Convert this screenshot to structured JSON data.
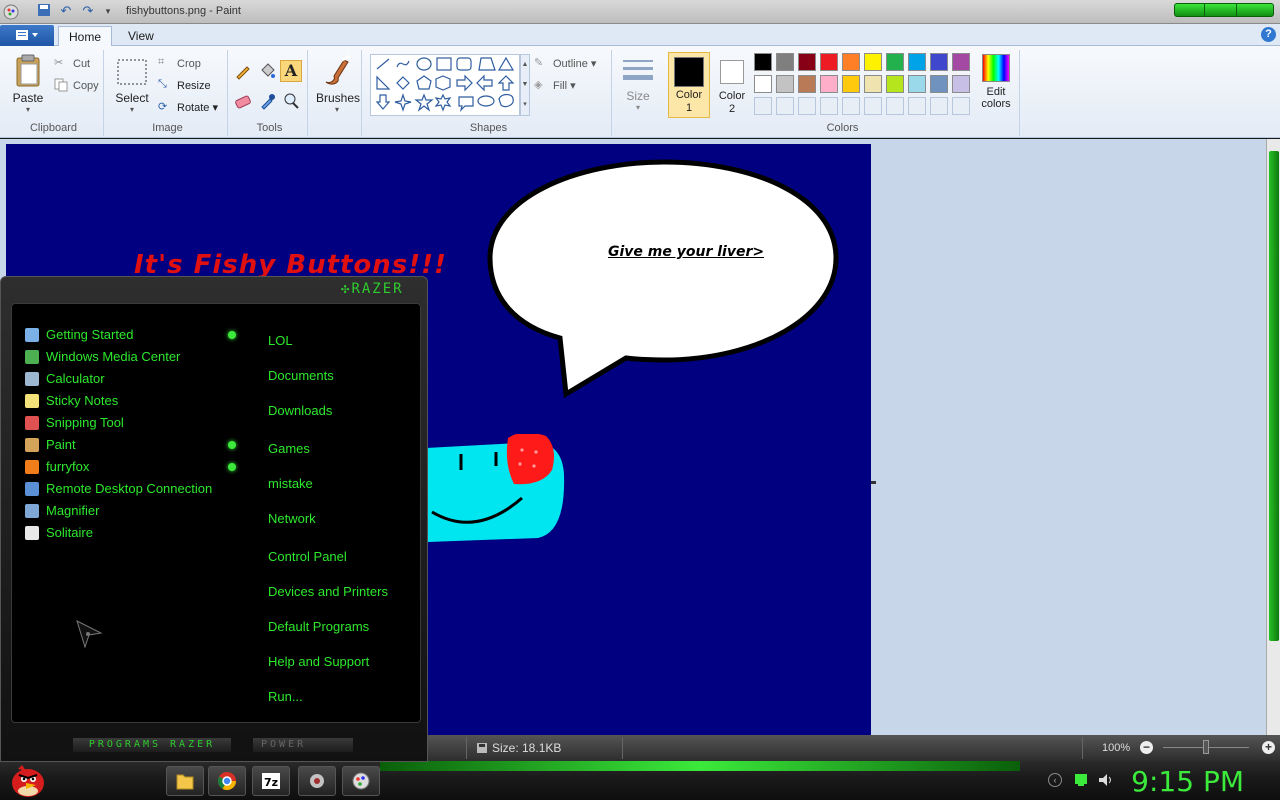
{
  "window": {
    "title": "fishybuttons.png - Paint"
  },
  "ribbon": {
    "tabs": [
      "Home",
      "View"
    ],
    "clipboard": {
      "paste": "Paste",
      "cut": "Cut",
      "copy": "Copy",
      "label": "Clipboard"
    },
    "image": {
      "select": "Select",
      "crop": "Crop",
      "resize": "Resize",
      "rotate": "Rotate",
      "label": "Image"
    },
    "tools": {
      "label": "Tools"
    },
    "brushes": {
      "label": "Brushes"
    },
    "shapes": {
      "outline": "Outline",
      "fill": "Fill",
      "label": "Shapes"
    },
    "size": {
      "label": "Size"
    },
    "colors": {
      "color1": "Color 1",
      "color2": "Color 2",
      "edit": "Edit colors",
      "label": "Colors",
      "palette_row1": [
        "#000000",
        "#7f7f7f",
        "#880015",
        "#ed1c24",
        "#ff7f27",
        "#fff200",
        "#22b14c",
        "#00a2e8",
        "#3f48cc",
        "#a349a4"
      ],
      "palette_row2": [
        "#ffffff",
        "#c3c3c3",
        "#b97a57",
        "#ffaec9",
        "#ffc90e",
        "#efe4b0",
        "#b5e61d",
        "#99d9ea",
        "#7092be",
        "#c8bfe7"
      ]
    }
  },
  "canvas": {
    "title": "It's Fishy Buttons!!!",
    "speech": "Give me your liver>"
  },
  "statusbar": {
    "size": "Size: 18.1KB",
    "zoom": "100%"
  },
  "startmenu": {
    "brand": "RAZER",
    "programs": [
      {
        "label": "Getting Started",
        "color": "#7ab0e6",
        "pinned": true
      },
      {
        "label": "Windows Media Center",
        "color": "#4caf50",
        "pinned": false
      },
      {
        "label": "Calculator",
        "color": "#9eb7d1",
        "pinned": false
      },
      {
        "label": "Sticky Notes",
        "color": "#f3e27a",
        "pinned": false
      },
      {
        "label": "Snipping Tool",
        "color": "#e05252",
        "pinned": false
      },
      {
        "label": "Paint",
        "color": "#d4a35a",
        "pinned": true
      },
      {
        "label": "furryfox",
        "color": "#f07d1a",
        "pinned": true
      },
      {
        "label": "Remote Desktop Connection",
        "color": "#5b8fd6",
        "pinned": false
      },
      {
        "label": "Magnifier",
        "color": "#7fa7d6",
        "pinned": false
      },
      {
        "label": "Solitaire",
        "color": "#e8e8e8",
        "pinned": false
      }
    ],
    "places": [
      "LOL",
      "Documents",
      "Downloads",
      "Games",
      "mistake",
      "Network",
      "Control Panel",
      "Devices and Printers",
      "Default Programs",
      "Help and Support",
      "Run..."
    ],
    "programs_button": "PROGRAMS RAZER",
    "power_button": "POWER"
  },
  "taskbar": {
    "clock": "9:15 PM"
  }
}
